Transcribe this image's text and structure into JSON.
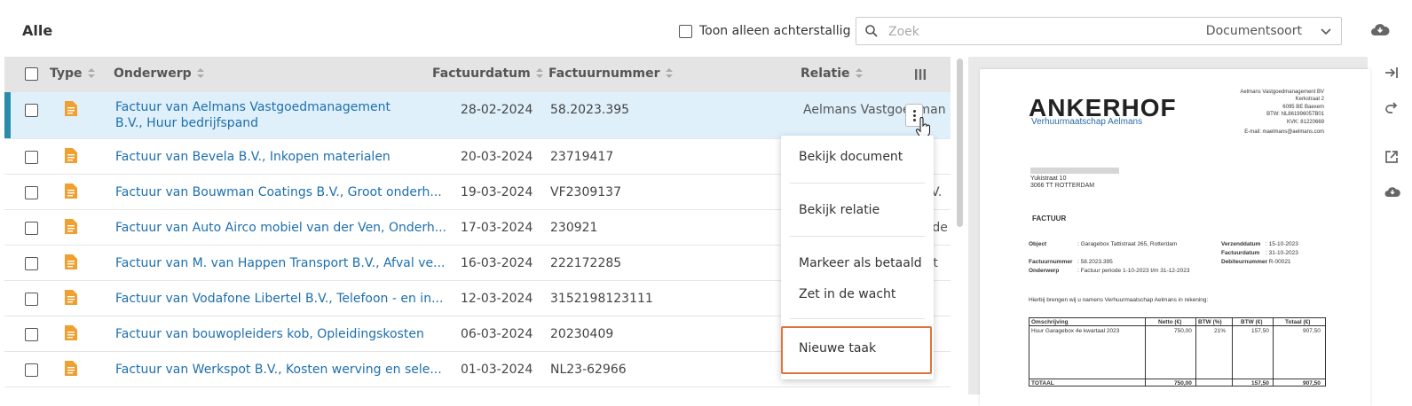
{
  "header": {
    "title": "Alle",
    "overdue_label": "Toon alleen achterstallig",
    "search_placeholder": "Zoek",
    "doctype_label": "Documentsoort"
  },
  "table": {
    "columns": [
      "Type",
      "Onderwerp",
      "Factuurdatum",
      "Factuurnummer",
      "Relatie"
    ],
    "rows": [
      {
        "subject": "Factuur van Aelmans Vastgoedmanagement B.V., Huur bedrijfspand",
        "date": "28-02-2024",
        "number": "58.2023.395",
        "relation": "Aelmans Vastgoedmanag"
      },
      {
        "subject": "Factuur van Bevela B.V., Inkopen materialen",
        "date": "20-03-2024",
        "number": "23719417",
        "relation": ""
      },
      {
        "subject": "Factuur van Bouwman Coatings B.V., Groot onderh...",
        "date": "19-03-2024",
        "number": "VF2309137",
        "relation": "B.V."
      },
      {
        "subject": "Factuur van Auto Airco mobiel van der Ven, Onderh...",
        "date": "17-03-2024",
        "number": "230921",
        "relation": "n de"
      },
      {
        "subject": "Factuur van M. van Happen Transport B.V., Afval ve...",
        "date": "16-03-2024",
        "number": "222172285",
        "relation": "ort"
      },
      {
        "subject": "Factuur van Vodafone Libertel B.V., Telefoon - en in...",
        "date": "12-03-2024",
        "number": "3152198123111",
        "relation": "."
      },
      {
        "subject": "Factuur van bouwopleiders kob, Opleidingskosten",
        "date": "06-03-2024",
        "number": "20230409",
        "relation": ""
      },
      {
        "subject": "Factuur van Werkspot B.V., Kosten werving en sele...",
        "date": "01-03-2024",
        "number": "NL23-62966",
        "relation": ""
      }
    ]
  },
  "context_menu": {
    "view_document": "Bekijk document",
    "view_relation": "Bekijk relatie",
    "mark_paid": "Markeer als betaald",
    "put_on_hold": "Zet in de wacht",
    "new_task": "Nieuwe taak"
  },
  "preview": {
    "logo": "ANKERHOF",
    "logo_sub": "Verhuurmaatschap Aelmans",
    "sender": [
      "Aelmans Vastgoedmanagement BV",
      "Kerkstraat 2",
      "6095 BE  Baexem",
      "BTW: NL861996057B01",
      "KVK:  81220669",
      "E-mail: maelmans@aelmans.com"
    ],
    "recipient": [
      "Yukistraat 10",
      "3066 TT  ROTTERDAM"
    ],
    "doc_title": "FACTUUR",
    "object_label": "Object",
    "object_value": ":  Garagebox Tattistraat 265, Rotterdam",
    "send_date_label": "Verzenddatum",
    "send_date_value": ":  15-10-2023",
    "invoice_date_label": "Factuurdatum",
    "invoice_date_value": ":  31-10-2023",
    "invoice_no_label": "Factuurnummer",
    "invoice_no_value": ":  58.2023.395",
    "debtor_label": "Debiteurnummer",
    "debtor_value": ":  R-00021",
    "subject_label": "Onderwerp",
    "subject_value": ":  Factuur periode 1-10-2023 t/m 31-12-2023",
    "intro": "Hierbij brengen wij u namens Verhuurmaatschap Aelmans in rekening:",
    "columns": [
      "Omschrijving",
      "Netto (€)",
      "BTW (%)",
      "BTW (€)",
      "Totaal (€)"
    ],
    "line": [
      "Huur Garagebox 4e kwartaal 2023",
      "750,00",
      "21%",
      "157,50",
      "907,50"
    ],
    "total": [
      "TOTAAL",
      "750,00",
      "157,50",
      "907,50"
    ]
  },
  "colors": {
    "accent": "#1d6fae",
    "selected_bg": "#dff0fa",
    "highlight": "#e0733a",
    "file_icon": "#f0a030"
  }
}
